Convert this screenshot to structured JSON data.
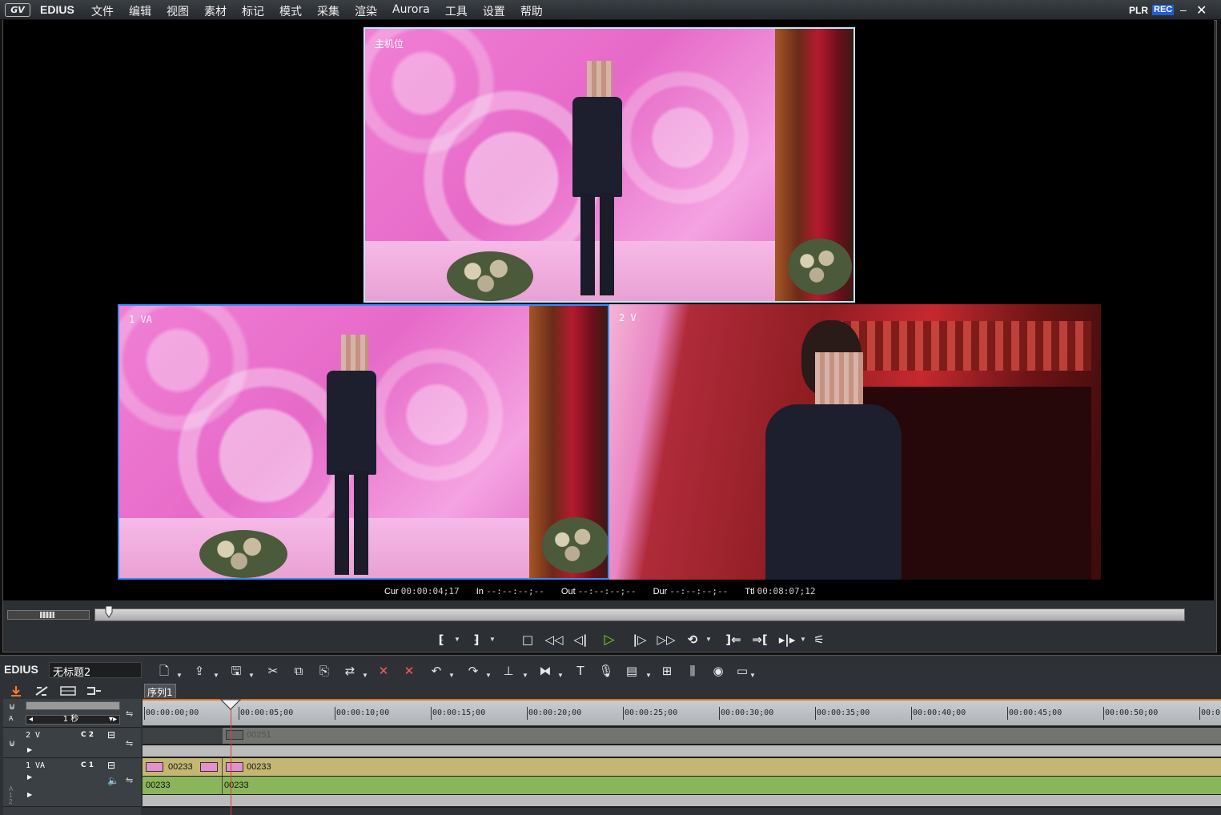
{
  "app": {
    "logo": "GV",
    "name": "EDIUS",
    "menus": [
      "文件",
      "编辑",
      "视图",
      "素材",
      "标记",
      "模式",
      "采集",
      "渲染",
      "Aurora",
      "工具",
      "设置",
      "帮助"
    ],
    "plr": "PLR",
    "rec": "REC",
    "min_icon": "minimize-icon",
    "close_icon": "close-icon",
    "min_glyph": "–",
    "close_glyph": "✕"
  },
  "preview": {
    "main_label": "主机位",
    "cam1_label": "1 VA",
    "cam2_label": "2 V",
    "info": {
      "cur_label": "Cur",
      "cur": "00:00:04;17",
      "in_label": "In",
      "in": "--:--:--;--",
      "out_label": "Out",
      "out": "--:--:--;--",
      "dur_label": "Dur",
      "dur": "--:--:--;--",
      "ttl_label": "Ttl",
      "ttl": "00:08:07;12"
    }
  },
  "transport": {
    "buttons": [
      {
        "name": "set-in-button",
        "glyph": "⁅"
      },
      {
        "name": "set-out-button",
        "glyph": "⁆"
      },
      {
        "name": "stop-button",
        "glyph": "□"
      },
      {
        "name": "rewind-button",
        "glyph": "◁◁"
      },
      {
        "name": "step-back-button",
        "glyph": "◁|"
      },
      {
        "name": "play-button",
        "glyph": "▷"
      },
      {
        "name": "step-forward-button",
        "glyph": "|▷"
      },
      {
        "name": "fast-forward-button",
        "glyph": "▷▷"
      },
      {
        "name": "loop-button",
        "glyph": "⟲"
      },
      {
        "name": "insert-button",
        "glyph": "]⇐"
      },
      {
        "name": "overwrite-button",
        "glyph": "⇒["
      },
      {
        "name": "replace-button",
        "glyph": "▸|▸"
      },
      {
        "name": "clip-options-button",
        "glyph": "⚟"
      }
    ]
  },
  "timeline": {
    "app_name": "EDIUS",
    "project": "无标题2",
    "sequence_tab": "序列1",
    "scale": "1 秒",
    "ruler": [
      "00:00:00;00",
      "00:00:05;00",
      "00:00:10;00",
      "00:00:15;00",
      "00:00:20;00",
      "00:00:25;00",
      "00:00:30;00",
      "00:00:35;00",
      "00:00:40;00",
      "00:00:45;00",
      "00:00:50;00",
      "00:0"
    ],
    "tracks": [
      {
        "name": "2 V",
        "channel": "C 2",
        "clip": "00251"
      },
      {
        "name": "1 VA",
        "channel": "C 1",
        "video_clips": [
          "00233",
          "00233"
        ],
        "audio_clips": [
          "00233",
          "00233"
        ]
      }
    ],
    "audio_track_tag": "A 1 2",
    "toolbar": [
      {
        "name": "new-file-icon",
        "glyph": "🗋"
      },
      {
        "name": "open-icon",
        "glyph": "⇪"
      },
      {
        "name": "save-icon",
        "glyph": "🖫"
      },
      {
        "name": "cut-icon",
        "glyph": "✂"
      },
      {
        "name": "copy-icon",
        "glyph": "⧉"
      },
      {
        "name": "paste-icon",
        "glyph": "⎘"
      },
      {
        "name": "replace-icon",
        "glyph": "⇄"
      },
      {
        "name": "delete-icon",
        "glyph": "✕"
      },
      {
        "name": "ripple-delete-icon",
        "glyph": "✕"
      },
      {
        "name": "undo-icon",
        "glyph": "↶"
      },
      {
        "name": "redo-icon",
        "glyph": "↷"
      },
      {
        "name": "add-cut-icon",
        "glyph": "⊥"
      },
      {
        "name": "transition-icon",
        "glyph": "⧓"
      },
      {
        "name": "title-icon",
        "glyph": "T"
      },
      {
        "name": "mic-icon",
        "glyph": "🎙"
      },
      {
        "name": "export-icon",
        "glyph": "▤"
      },
      {
        "name": "multicam-grid-icon",
        "glyph": "⊞"
      },
      {
        "name": "mixer-icon",
        "glyph": "⫼"
      },
      {
        "name": "color-icon",
        "glyph": "◉"
      },
      {
        "name": "layout-icon",
        "glyph": "▭"
      }
    ]
  }
}
